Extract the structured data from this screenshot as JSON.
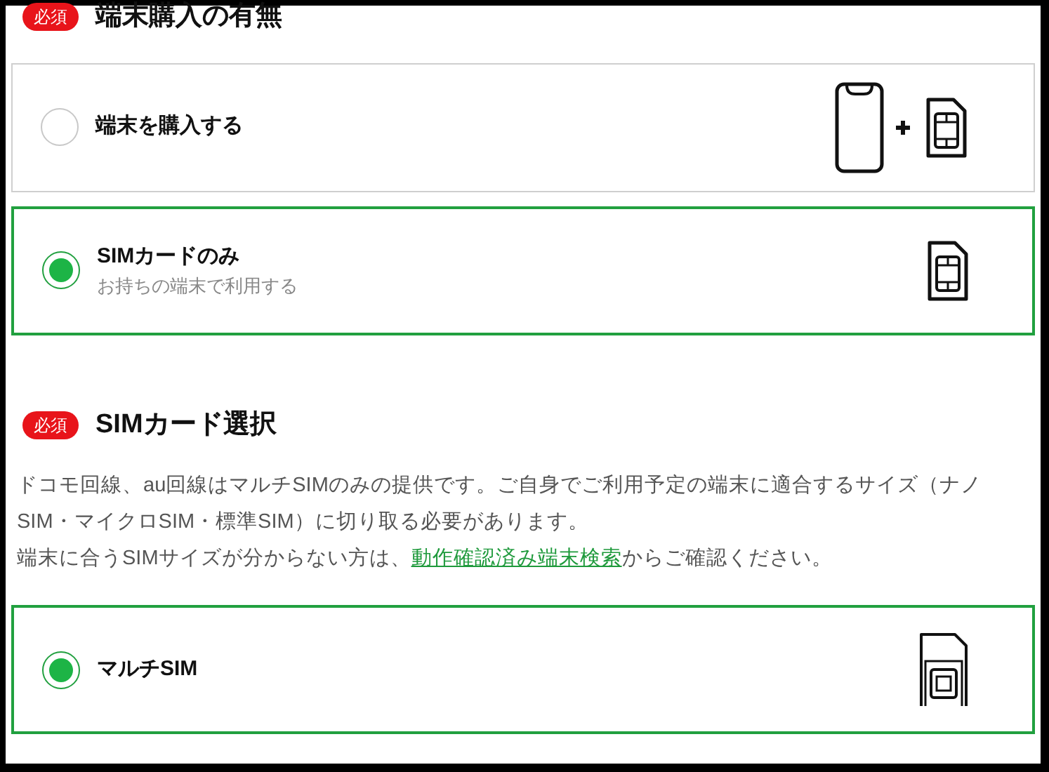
{
  "sections": [
    {
      "badge": "必須",
      "title": "端末購入の有無",
      "options": [
        {
          "label": "端末を購入する",
          "selected": false,
          "kind": "phone_plus_sim"
        },
        {
          "label": "SIMカードのみ",
          "sublabel": "お持ちの端末で利用する",
          "selected": true,
          "kind": "sim"
        }
      ]
    },
    {
      "badge": "必須",
      "title": "SIMカード選択",
      "description": [
        {
          "text": "ドコモ回線、au回線はマルチSIMのみの提供です。ご自身でご利用予定の端末に適合するサイズ（ナノSIM・マイクロSIM・標準SIM）に切り取る必要があります。"
        },
        {
          "text": "端末に合うSIMサイズが分からない方は、",
          "link": "動作確認済み端末検索",
          "after": "からご確認ください。"
        }
      ],
      "options": [
        {
          "label": "マルチSIM",
          "selected": true,
          "kind": "multi_sim"
        }
      ]
    }
  ]
}
